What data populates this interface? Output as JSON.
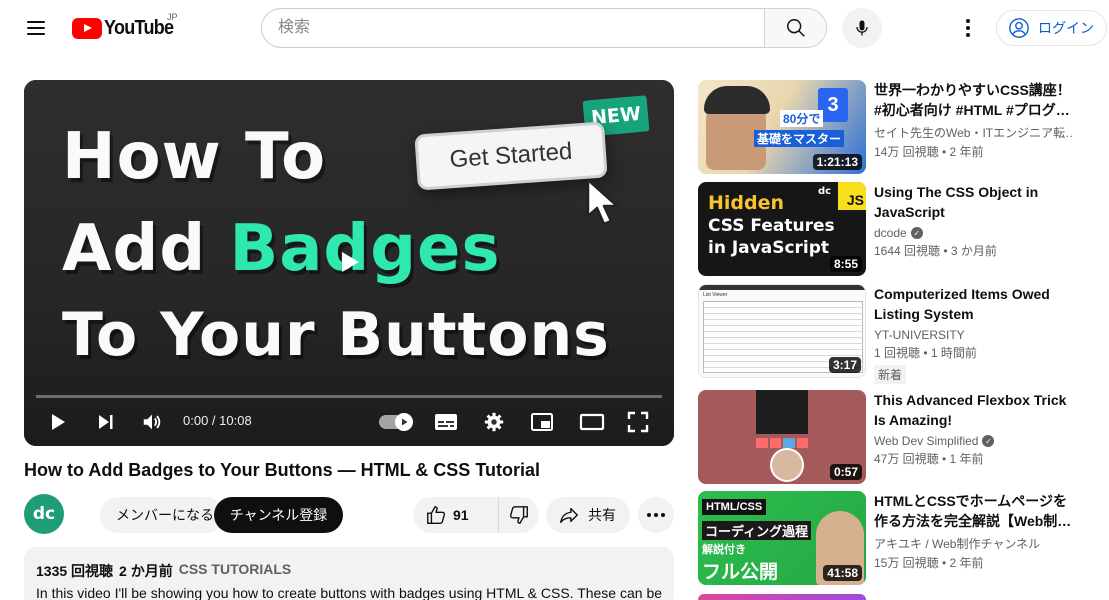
{
  "header": {
    "logo_text": "YouTube",
    "region": "JP",
    "search_placeholder": "検索",
    "login_label": "ログイン"
  },
  "player": {
    "thumbnail_lines": [
      "How To",
      "Add",
      "Badges",
      "To Your Buttons"
    ],
    "button_text": "Get Started",
    "badge_text": "NEW",
    "time": "0:00 / 10:08",
    "progress": 0
  },
  "video": {
    "title": "How to Add Badges to Your Buttons — HTML & CSS Tutorial",
    "channel_avatar_text": "dc",
    "member_label": "メンバーになる",
    "subscribe_label": "チャンネル登録",
    "likes": "91",
    "share_label": "共有"
  },
  "description": {
    "views": "1335 回視聴",
    "date": "2 か月前",
    "tag": "CSS TUTORIALS",
    "text": "In this video I'll be showing you how to create buttons with badges using HTML & CSS. These can be"
  },
  "related": [
    {
      "title": "世界一わかりやすいCSS講座！#初心者向け #HTML #プログ…",
      "channel": "セイト先生のWeb・ITエンジニア転…",
      "verified": false,
      "stats": "14万 回視聴 • 2 年前",
      "duration": "1:21:13",
      "thumb_text": [
        "80分で",
        "基礎をマスター"
      ],
      "badge": ""
    },
    {
      "title": "Using The CSS Object in JavaScript",
      "channel": "dcode",
      "verified": true,
      "stats": "1644 回視聴 • 3 か月前",
      "duration": "8:55",
      "thumb_text": [
        "Hidden",
        "CSS Features",
        "in JavaScript",
        "JS",
        "dc"
      ],
      "badge": ""
    },
    {
      "title": "Computerized Items Owed Listing System",
      "channel": "YT-UNIVERSITY",
      "verified": false,
      "stats": "1 回視聴 • 1 時間前",
      "duration": "3:17",
      "thumb_text": [
        "List Viewer"
      ],
      "badge": "新着"
    },
    {
      "title": "This Advanced Flexbox Trick Is Amazing!",
      "channel": "Web Dev Simplified",
      "verified": true,
      "stats": "47万 回視聴 • 1 年前",
      "duration": "0:57",
      "thumb_text": [],
      "badge": ""
    },
    {
      "title": "HTMLとCSSでホームページを作る方法を完全解説【Web制…",
      "channel": "アキユキ / Web制作チャンネル",
      "verified": false,
      "stats": "15万 回視聴 • 2 年前",
      "duration": "41:58",
      "thumb_text": [
        "HTML/CSS",
        "コーディング過程",
        "解説付き",
        "フル公開"
      ],
      "badge": ""
    }
  ],
  "colors": {
    "accent": "#2ee8b0",
    "brand_red": "#ff0000",
    "link_blue": "#065fd4",
    "channel_green": "#1f9d78"
  }
}
